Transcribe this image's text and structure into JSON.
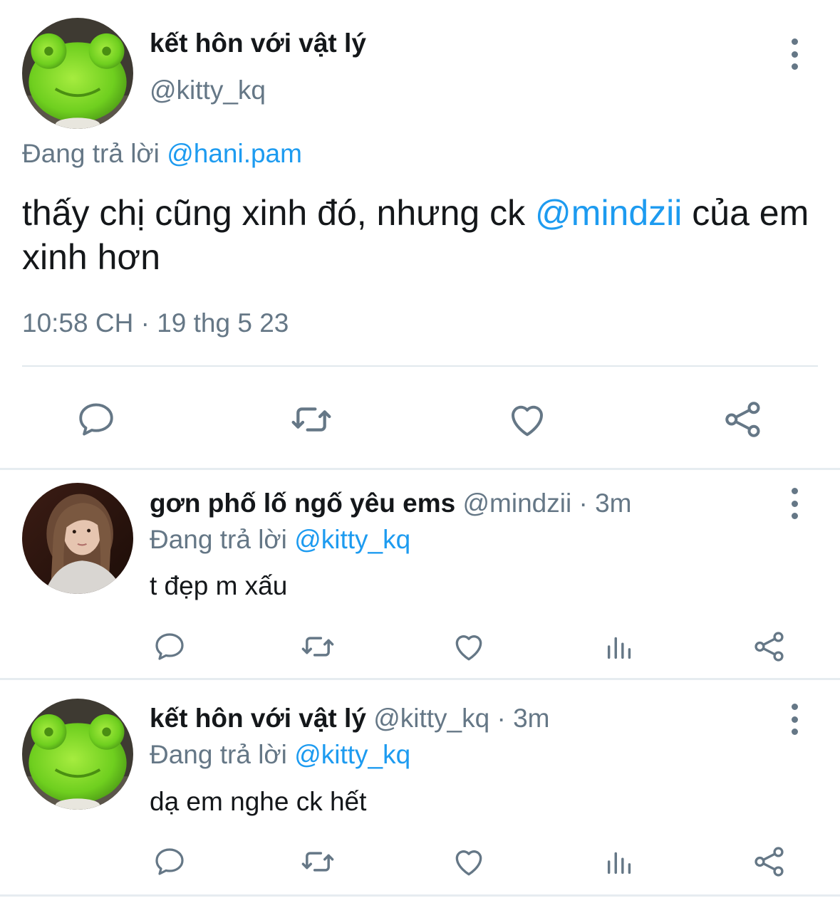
{
  "main_tweet": {
    "author_name": "kết hôn với vật lý",
    "author_handle": "@kitty_kq",
    "replying_prefix": "Đang trả lời",
    "replying_to": "@hani.pam",
    "text_before": "thấy chị cũng xinh đó, nhưng ck ",
    "text_mention": "@mindzii",
    "text_after": " của em xinh hơn",
    "timestamp": "10:58 CH · 19 thg 5 23",
    "actions": [
      "reply-icon",
      "retweet-icon",
      "like-icon",
      "share-icon"
    ]
  },
  "replies": [
    {
      "author_name": "gơn phố lố ngố yêu ems",
      "author_handle": "@mindzii",
      "age": "3m",
      "separator": " · ",
      "replying_prefix": "Đang trả lời",
      "replying_to": "@kitty_kq",
      "text": "t đẹp m xấu",
      "actions": [
        "reply-icon",
        "retweet-icon",
        "like-icon",
        "analytics-icon",
        "share-icon"
      ]
    },
    {
      "author_name": "kết hôn với vật lý",
      "author_handle": "@kitty_kq",
      "age": "3m",
      "separator": " · ",
      "replying_prefix": "Đang trả lời",
      "replying_to": "@kitty_kq",
      "text": "dạ em nghe ck hết",
      "actions": [
        "reply-icon",
        "retweet-icon",
        "like-icon",
        "analytics-icon",
        "share-icon"
      ]
    }
  ],
  "colors": {
    "text": "#14171a",
    "secondary": "#657786",
    "link": "#1d9bf0",
    "divider": "#e6ecf0"
  }
}
